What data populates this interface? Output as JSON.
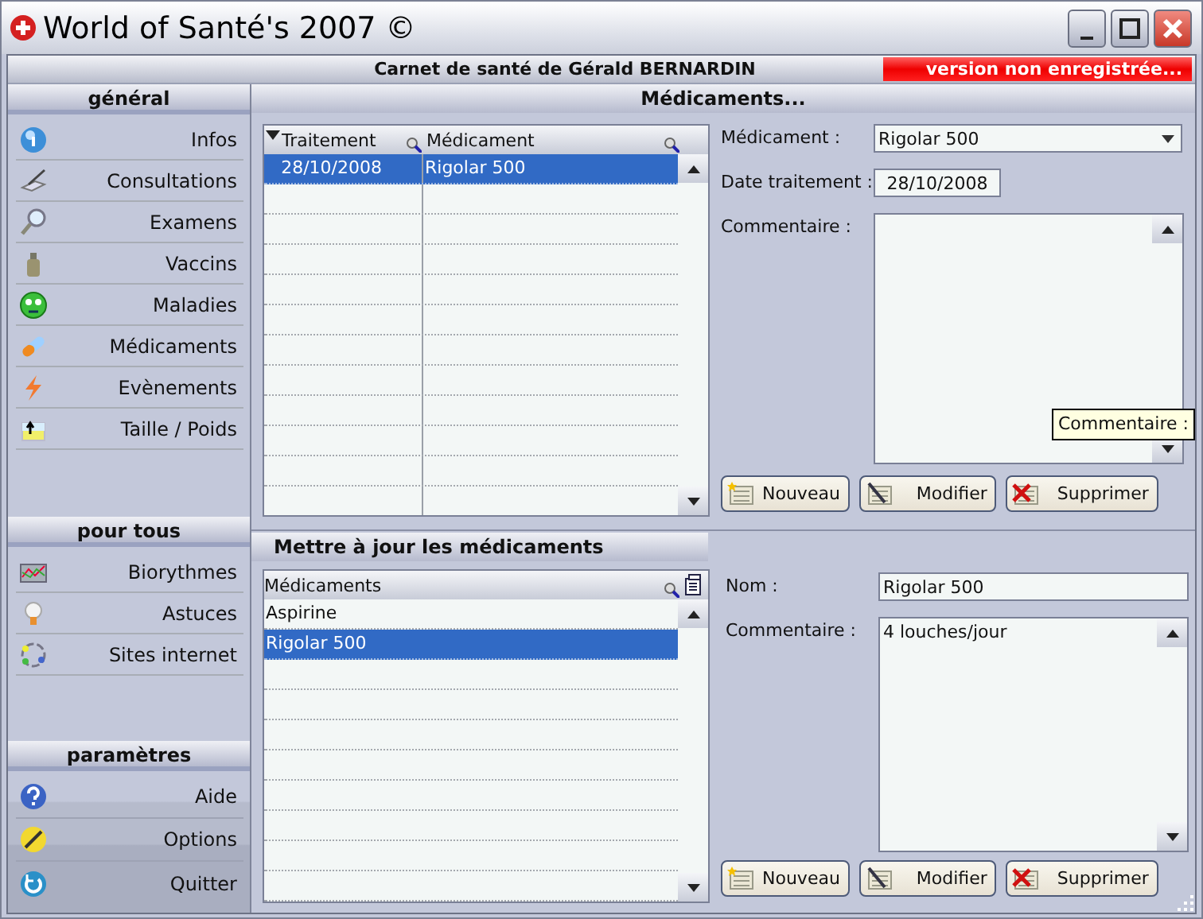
{
  "window": {
    "title": "World of Santé's 2007 ©"
  },
  "header": {
    "title": "Carnet de santé de Gérald BERNARDIN",
    "badge": "version non enregistrée..."
  },
  "sidebar": {
    "sections": [
      {
        "title": "général",
        "items": [
          {
            "label": "Infos",
            "kind": "info"
          },
          {
            "label": "Consultations",
            "kind": "consultation"
          },
          {
            "label": "Examens",
            "kind": "exam"
          },
          {
            "label": "Vaccins",
            "kind": "vaccine"
          },
          {
            "label": "Maladies",
            "kind": "disease"
          },
          {
            "label": "Médicaments",
            "kind": "pill"
          },
          {
            "label": "Evènements",
            "kind": "event"
          },
          {
            "label": "Taille / Poids",
            "kind": "size"
          }
        ]
      },
      {
        "title": "pour tous",
        "items": [
          {
            "label": "Biorythmes",
            "kind": "chart"
          },
          {
            "label": "Astuces",
            "kind": "bulb"
          },
          {
            "label": "Sites internet",
            "kind": "web"
          }
        ]
      },
      {
        "title": "paramètres",
        "items": [
          {
            "label": "Aide",
            "kind": "help"
          },
          {
            "label": "Options",
            "kind": "options"
          },
          {
            "label": "Quitter",
            "kind": "quit"
          }
        ]
      }
    ]
  },
  "treatments": {
    "title": "Médicaments...",
    "columns": [
      "Traitement",
      "Médicament"
    ],
    "rows": [
      {
        "cells": [
          "28/10/2008",
          "Rigolar 500"
        ],
        "selected": true
      }
    ],
    "form": {
      "medicament_label": "Médicament :",
      "medicament_value": "Rigolar 500",
      "date_label": "Date traitement :",
      "date_value": "28/10/2008",
      "comment_label": "Commentaire :"
    },
    "buttons": [
      {
        "label": "Nouveau",
        "kind": "new"
      },
      {
        "label": "Modifier",
        "kind": "edit"
      },
      {
        "label": "Supprimer",
        "kind": "delete"
      }
    ]
  },
  "tooltip": "Commentaire :",
  "update": {
    "title": "Mettre à jour les médicaments",
    "column": "Médicaments",
    "items": [
      {
        "label": "Aspirine",
        "selected": false
      },
      {
        "label": "Rigolar 500",
        "selected": true
      }
    ],
    "form": {
      "name_label": "Nom :",
      "name_value": "Rigolar 500",
      "comment_label": "Commentaire :",
      "comment_value": "4 louches/jour"
    },
    "buttons": [
      {
        "label": "Nouveau",
        "kind": "new"
      },
      {
        "label": "Modifier",
        "kind": "edit"
      },
      {
        "label": "Supprimer",
        "kind": "delete"
      }
    ]
  }
}
